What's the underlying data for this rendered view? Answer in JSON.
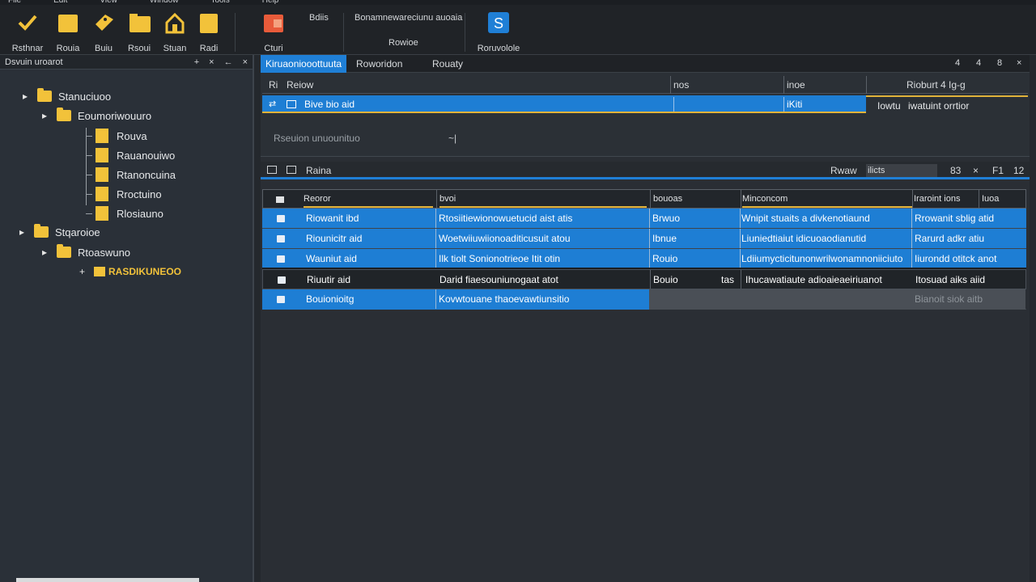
{
  "menu": [
    "File",
    "Edit",
    "View",
    "Window",
    "Tools",
    "Help"
  ],
  "toolbar": {
    "buttons": [
      {
        "label": "Rsthnar",
        "icon": "checkmark-icon"
      },
      {
        "label": "Rouia",
        "icon": "folder-icon"
      },
      {
        "label": "Buiu",
        "icon": "tag-icon"
      },
      {
        "label": "Rsoui",
        "icon": "folder-icon"
      },
      {
        "label": "Stuan",
        "icon": "house-icon"
      },
      {
        "label": "Radi",
        "icon": "folder-icon"
      },
      {
        "label": "Cturi",
        "icon": "chart-icon"
      }
    ],
    "group1_top": "Bdiis",
    "group2_top": "Bonamnewareciunu auoaia",
    "group2_label": "Rowioe",
    "group3_label": "Roruvolole",
    "group3_icon": "script-icon"
  },
  "left_panel": {
    "title": "Dsvuin uroarot",
    "controls": [
      "+",
      "×",
      "←",
      "×"
    ],
    "tree": [
      {
        "label": "Stanuciuoo",
        "level": 0,
        "type": "folder"
      },
      {
        "label": "Eoumoriwouuro",
        "level": 1,
        "type": "folder"
      },
      {
        "label": "Rouva",
        "level": 2,
        "type": "doc"
      },
      {
        "label": "Rauanouiwo",
        "level": 2,
        "type": "doc"
      },
      {
        "label": "Rtanoncuina",
        "level": 2,
        "type": "doc"
      },
      {
        "label": "Rroctuino",
        "level": 2,
        "type": "doc"
      },
      {
        "label": "Rlosiauno",
        "level": 2,
        "type": "doc"
      },
      {
        "label": "Stqaroioe",
        "level": 0,
        "type": "folder"
      },
      {
        "label": "Rtoaswuno",
        "level": 1,
        "type": "folder"
      },
      {
        "label": "RASDIKUNEOO",
        "level": 2,
        "type": "highlight"
      }
    ]
  },
  "tabs": [
    "Kiruaoniooottuuta",
    "Roworidon",
    "Rouaty"
  ],
  "tab_controls": [
    "4",
    "4",
    "8",
    "×"
  ],
  "upper_table": {
    "headers": [
      "Ri",
      "Reiow",
      "nos",
      "inoe",
      "Rioburt 4 Ig-g"
    ],
    "row": {
      "icon": "grid-icon",
      "name": "Bive bio aid",
      "c3": "",
      "c4": "iKiti",
      "c5": "Iowtu",
      "c6": "iwatuint orrtior"
    },
    "status": "Rseuion unuounituo",
    "status_mark": "~|"
  },
  "lower_bar": {
    "label": "Raina",
    "filter_label": "Rwaw",
    "filter_value": "ilicts",
    "controls": [
      "83",
      "×",
      "F1",
      "12"
    ]
  },
  "grid": {
    "headers": [
      "Reoror",
      "bvoi",
      "bouoas",
      "Minconcom",
      "Iraroint ions",
      "Iuoa"
    ],
    "rows": [
      {
        "c1": "Riowanit ibd",
        "c2": "Rtosiitiewionowuetucid aist atis",
        "c3": "Brwuo",
        "c4": "Wnipit stuaits a divkenotiaund",
        "c5": "Rrowanit sblig atid",
        "style": "sel"
      },
      {
        "c1": "Riounicitr aid",
        "c2": "Woetwiiuwiionoaditicusuit atou",
        "c3": "Ibnue",
        "c4": "Liuniedtiaiut idicuoaodianutid",
        "c5": "Rarurd adkr atiu",
        "style": "sel"
      },
      {
        "c1": "Wauniut aid",
        "c2": "Ilk tiolt Sonionotrieoe Itit otin",
        "c3": "Rouio",
        "c4": "Ldiiumycticitunonwrilwonamnoniiciuto",
        "c5": "Iiurondd otitck anot",
        "style": "sel"
      },
      {
        "c1": "Riuutir aid",
        "c2": "Darid fiaesouniunogaat atot",
        "c3": "Bouio",
        "c3b": "tas",
        "c4": "Ihucawatiaute adioaieaeiriuanot",
        "c5": "Itosuad aiks aiid",
        "style": "dark"
      },
      {
        "c1": "Bouionioitg",
        "c2": "Kovwtouane thaoevawtiunsitio",
        "c3": "",
        "c4": "",
        "c5": "Bianoit siok aitb",
        "style": "sel-partial"
      }
    ]
  },
  "colors": {
    "accent": "#1f7fd6",
    "folder": "#f2c23a",
    "highlight_text": "#f2c23a",
    "background": "#24282d"
  }
}
